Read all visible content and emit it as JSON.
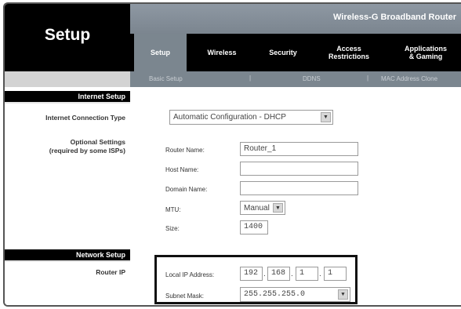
{
  "brand": {
    "title": "Wireless-G Broadband Router"
  },
  "sidebar": {
    "header": "Setup",
    "sections": [
      {
        "title": "Internet Setup"
      },
      {
        "title": "Network Setup"
      }
    ],
    "labels": {
      "connection_type": "Internet Connection Type",
      "optional_line1": "Optional Settings",
      "optional_line2": "(required by some ISPs)",
      "router_ip": "Router IP"
    }
  },
  "tabs": [
    {
      "line1": "Setup",
      "line2": "",
      "active": true
    },
    {
      "line1": "Wireless",
      "line2": ""
    },
    {
      "line1": "Security",
      "line2": ""
    },
    {
      "line1": "Access",
      "line2": "Restrictions"
    },
    {
      "line1": "Applications",
      "line2": "& Gaming"
    }
  ],
  "subnav": [
    {
      "label": "Basic Setup"
    },
    {
      "label": "DDNS"
    },
    {
      "label": "MAC Address Clone"
    }
  ],
  "internet": {
    "connection_type_value": "Automatic Configuration - DHCP",
    "fields": {
      "router_name": {
        "label": "Router Name:",
        "value": "Router_1"
      },
      "host_name": {
        "label": "Host Name:",
        "value": ""
      },
      "domain_name": {
        "label": "Domain Name:",
        "value": ""
      },
      "mtu": {
        "label": "MTU:",
        "value": "Manual"
      },
      "size": {
        "label": "Size:",
        "value": "1400"
      }
    }
  },
  "network": {
    "local_ip_label": "Local IP Address:",
    "local_ip": [
      "192",
      "168",
      "1",
      "1"
    ],
    "subnet_label": "Subnet Mask:",
    "subnet_value": "255.255.255.0"
  },
  "colors": {
    "black": "#000000",
    "tab_active": "#7b868f",
    "title_bar": "#8e98a3",
    "highlight_border": "#111111"
  },
  "icons": {
    "dropdown": "chevron-down-icon"
  }
}
